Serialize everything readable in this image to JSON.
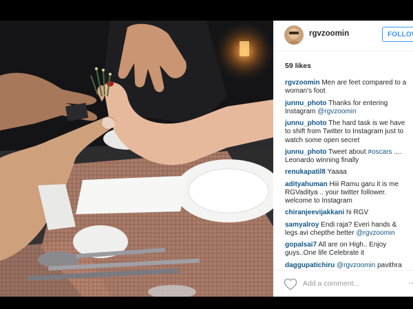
{
  "post": {
    "username": "rgvzoomin",
    "follow_label": "FOLLOW",
    "likes": "59 likes",
    "add_comment_placeholder": "Add a comment...",
    "more_glyph": "⋯"
  },
  "comments": [
    {
      "user": "rgvzoomin",
      "text": "Men are feet compared to a woman's foot"
    },
    {
      "user": "junnu_photo",
      "text": "Thanks for entering Instagram ",
      "mention": "@rgvzoomin"
    },
    {
      "user": "junnu_photo",
      "text": "The hard task is we have to shift from Twitter to Instagram just to watch some open secret"
    },
    {
      "user": "junnu_photo",
      "text": "Tweet about ",
      "mention": "#oscars",
      "after": " .... Leonardo winning finally"
    },
    {
      "user": "renukapatil8",
      "text": "Yaaaa"
    },
    {
      "user": "adityahuman",
      "text": "Hiii Ramu garu it is me RGVaditya .. your twitter follower. welcome to Instagram"
    },
    {
      "user": "chiranjeevijakkani",
      "text": "hi RGV"
    },
    {
      "user": "samyalroy",
      "text": "Endi raja? Everi hands & legs avi chepthe better ",
      "mention": "@rgvzoomin"
    },
    {
      "user": "gopalsai7",
      "text": "All are on High.. Enjoy guys..One life Celebrate it"
    },
    {
      "user": "daggupatichiru",
      "text": "",
      "mention": "@rgvzoomin",
      "after": " pavithra"
    }
  ],
  "icons": {
    "heart": "heart-icon",
    "avatar": "avatar-image"
  },
  "colors": {
    "link": "#125688",
    "follow": "#3897f0",
    "text": "#262626",
    "muted": "#999999"
  }
}
